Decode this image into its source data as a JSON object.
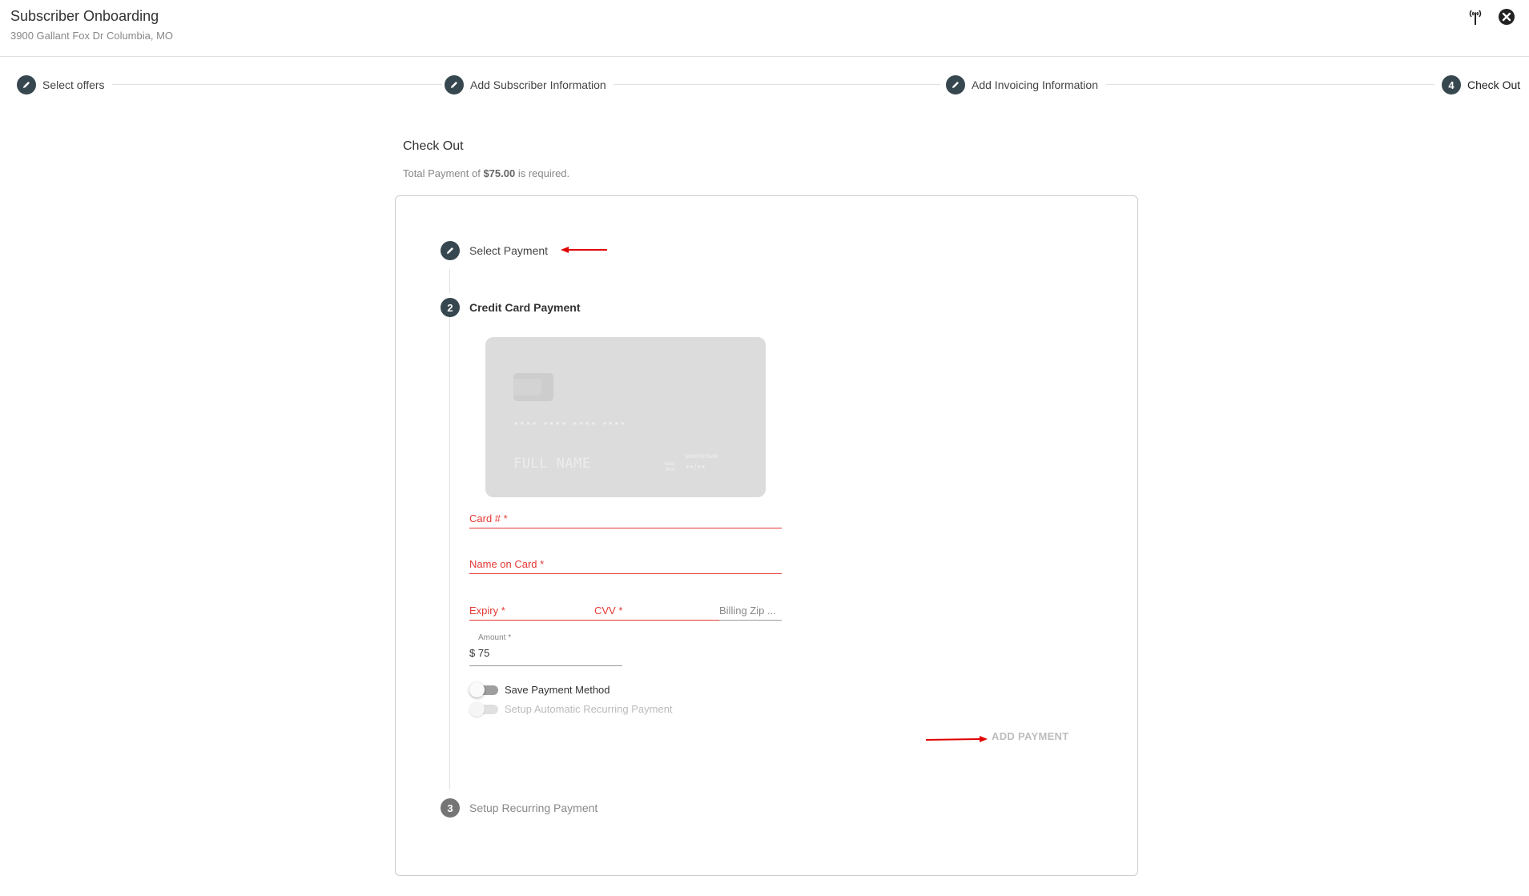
{
  "header": {
    "title": "Subscriber Onboarding",
    "subtitle": "3900 Gallant Fox Dr Columbia, MO",
    "icons": [
      "antenna-icon",
      "close-circle-icon"
    ]
  },
  "stepper": {
    "steps": [
      {
        "label": "Select offers",
        "state": "completed",
        "icon": "pencil-icon"
      },
      {
        "label": "Add Subscriber Information",
        "state": "completed",
        "icon": "pencil-icon"
      },
      {
        "label": "Add Invoicing Information",
        "state": "completed",
        "icon": "pencil-icon"
      },
      {
        "label": "Check Out",
        "state": "active",
        "number": "4"
      }
    ]
  },
  "checkout": {
    "title": "Check Out",
    "subtitle_prefix": "Total Payment of ",
    "subtitle_amount": "$75.00",
    "subtitle_suffix": " is required."
  },
  "payment_steps": [
    {
      "label": "Select Payment",
      "state": "completed",
      "icon": "pencil-icon"
    },
    {
      "label": "Credit Card Payment",
      "state": "active",
      "number": "2"
    },
    {
      "label": "Setup Recurring Payment",
      "state": "disabled",
      "number": "3"
    }
  ],
  "card_preview": {
    "number": "•••• •••• •••• ••••",
    "name": "FULL NAME",
    "valid_label_1": "valid",
    "valid_label_2": "thru",
    "month_year_label": "MONTH/YEAR",
    "expiry": "••/••"
  },
  "form": {
    "card_number_label": "Card # *",
    "name_on_card_label": "Name on Card *",
    "expiry_label": "Expiry *",
    "cvv_label": "CVV *",
    "billing_zip_label": "Billing Zip ...",
    "amount_label": "Amount *",
    "amount_value": "$ 75",
    "save_payment_label": "Save Payment Method",
    "save_payment_on": false,
    "recurring_label": "Setup Automatic Recurring Payment",
    "recurring_on": false,
    "recurring_disabled": true,
    "add_payment_label": "ADD PAYMENT"
  },
  "annotations": {
    "arrow_color": "#e00000"
  },
  "colors": {
    "step_circle": "#37474f",
    "error": "#e53935",
    "disabled_step": "#757575"
  }
}
